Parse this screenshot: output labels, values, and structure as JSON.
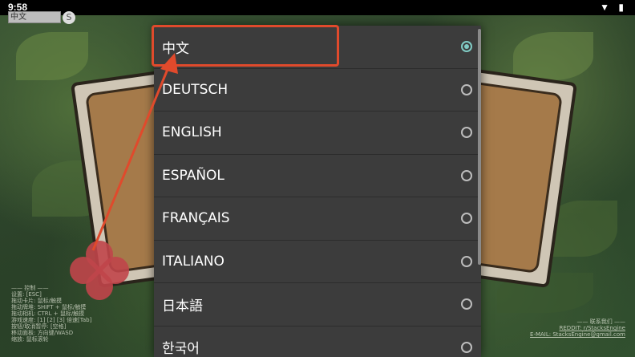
{
  "status_bar": {
    "time": "9:58",
    "icons": "▼ ▮"
  },
  "top_field": {
    "value": "中文"
  },
  "top_button": {
    "label": "S"
  },
  "languages": [
    {
      "label": "中文",
      "selected": true
    },
    {
      "label": "DEUTSCH",
      "selected": false
    },
    {
      "label": "ENGLISH",
      "selected": false
    },
    {
      "label": "ESPAÑOL",
      "selected": false
    },
    {
      "label": "FRANÇAIS",
      "selected": false
    },
    {
      "label": "ITALIANO",
      "selected": false
    },
    {
      "label": "日本語",
      "selected": false
    },
    {
      "label": "한국어",
      "selected": false
    }
  ],
  "help_text": "—— 控制 ——\n设置: [ESC]\n拖动卡片: 鼠标/触摸\n拖动牌堆: SHIFT + 鼠标/触摸\n拖动相机: CTRL + 鼠标/触摸\n游戏速度: [1] [2] [3] 倍速[Tab]\n按钮/取消暂停: [空格]\n移动面板: 方向键/WASD\n缩放: 鼠标滚轮",
  "contact": {
    "heading": "—— 联系我们 ——",
    "reddit": "REDDIT: r/StacksEngine",
    "email": "E-MAIL: StacksEngine@gmail.com"
  },
  "colors": {
    "accent": "#80cbc4",
    "annotation": "#e04a2c",
    "dialog_bg": "#3c3c3c"
  }
}
